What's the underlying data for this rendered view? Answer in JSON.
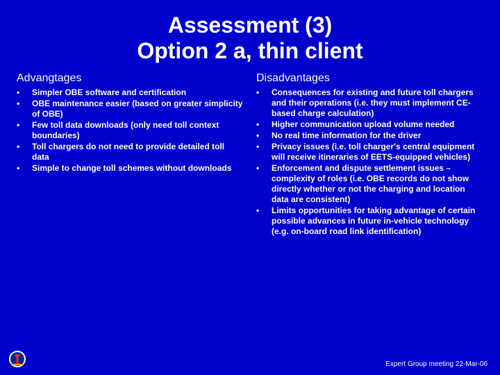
{
  "title_line1": "Assessment (3)",
  "title_line2": "Option 2 a, thin client",
  "left": {
    "heading": "Advangtages",
    "items": [
      "Simpler OBE software and certification",
      "OBE maintenance easier (based on greater simplicity of OBE)",
      "Few toll data downloads (only need toll context boundaries)",
      "Toll chargers do not need to provide detailed toll data",
      "Simple to change toll schemes without downloads"
    ]
  },
  "right": {
    "heading": "Disadvantages",
    "items": [
      "Consequences for existing and future toll chargers and their operations (i.e. they must implement CE-based charge calculation)",
      "Higher communication upload volume needed",
      "No real time information for the driver",
      "Privacy issues (i.e. toll charger's central equipment will receive itineraries of EETS-equipped vehicles)",
      "Enforcement and dispute settlement issues – complexity of roles (i.e. OBE records do not show directly whether or not the charging and location data are consistent)",
      "Limits opportunities for taking advantage of certain possible advances in future in-vehicle technology (e.g. on-board road link identification)"
    ]
  },
  "footer": "Expert Group meeting 22-Mar-06"
}
